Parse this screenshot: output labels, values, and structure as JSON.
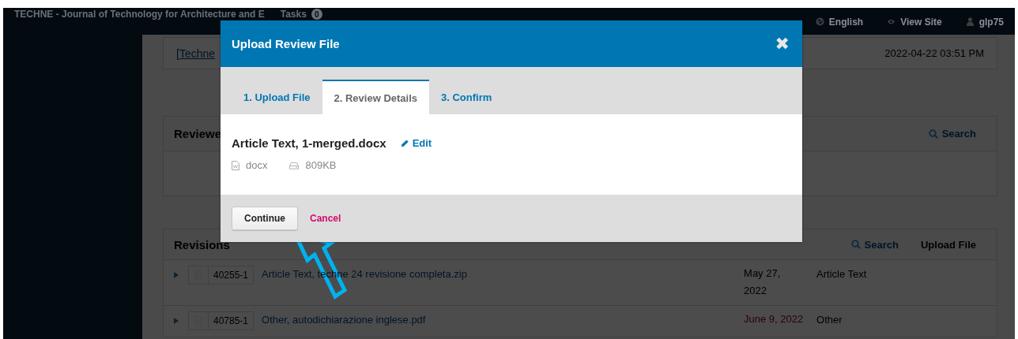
{
  "top_bar": {
    "site_title": "TECHNE - Journal of Technology for Architecture and E",
    "tasks": {
      "label": "Tasks",
      "count": "0"
    },
    "links": [
      {
        "kind": "language",
        "label": "English"
      },
      {
        "kind": "view_site",
        "label": "View Site"
      },
      {
        "kind": "user",
        "label": "glp75"
      }
    ]
  },
  "submission_card": {
    "title": "[Techne",
    "date": "2022-04-22 03:51 PM"
  },
  "reviewer_panel": {
    "heading": "Reviewe",
    "actions": [
      {
        "kind": "search",
        "label": "Search"
      }
    ]
  },
  "revisions_panel": {
    "heading": "Revisions",
    "actions": [
      {
        "kind": "search",
        "label": "Search"
      },
      {
        "kind": "plain",
        "label": "Upload File"
      }
    ],
    "rows": [
      {
        "id": "40255-1",
        "kind": "zip",
        "name": "Article Text, techne 24 revisione completa.zip",
        "date": "May 27, 2022",
        "overdue": false,
        "type": "Article Text"
      },
      {
        "id": "40785-1",
        "kind": "pdf",
        "name": "Other, autodichiarazione inglese.pdf",
        "date": "June 9, 2022",
        "overdue": true,
        "type": "Other"
      }
    ]
  },
  "modal": {
    "title": "Upload Review File",
    "close": "✖",
    "tabs": [
      {
        "label": "1. Upload File",
        "selected": false
      },
      {
        "label": "2. Review Details",
        "selected": true
      },
      {
        "label": "3. Confirm",
        "selected": false
      }
    ],
    "file": {
      "name": "Article Text, 1-merged.docx",
      "edit_label": "Edit",
      "format": "docx",
      "size": "809KB"
    },
    "buttons": [
      {
        "kind": "primary",
        "label": "Continue"
      },
      {
        "kind": "cancel",
        "label": "Cancel"
      }
    ]
  }
}
